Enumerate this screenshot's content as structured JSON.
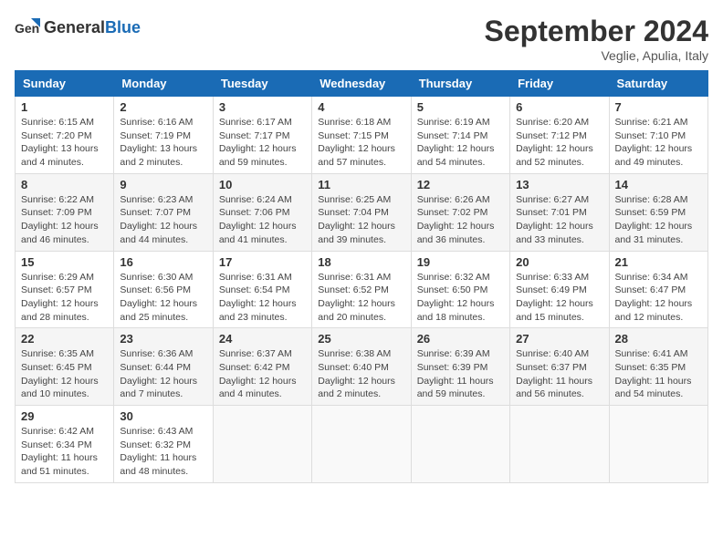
{
  "logo": {
    "text_general": "General",
    "text_blue": "Blue"
  },
  "title": "September 2024",
  "subtitle": "Veglie, Apulia, Italy",
  "weekdays": [
    "Sunday",
    "Monday",
    "Tuesday",
    "Wednesday",
    "Thursday",
    "Friday",
    "Saturday"
  ],
  "weeks": [
    [
      {
        "day": "1",
        "info": "Sunrise: 6:15 AM\nSunset: 7:20 PM\nDaylight: 13 hours\nand 4 minutes."
      },
      {
        "day": "2",
        "info": "Sunrise: 6:16 AM\nSunset: 7:19 PM\nDaylight: 13 hours\nand 2 minutes."
      },
      {
        "day": "3",
        "info": "Sunrise: 6:17 AM\nSunset: 7:17 PM\nDaylight: 12 hours\nand 59 minutes."
      },
      {
        "day": "4",
        "info": "Sunrise: 6:18 AM\nSunset: 7:15 PM\nDaylight: 12 hours\nand 57 minutes."
      },
      {
        "day": "5",
        "info": "Sunrise: 6:19 AM\nSunset: 7:14 PM\nDaylight: 12 hours\nand 54 minutes."
      },
      {
        "day": "6",
        "info": "Sunrise: 6:20 AM\nSunset: 7:12 PM\nDaylight: 12 hours\nand 52 minutes."
      },
      {
        "day": "7",
        "info": "Sunrise: 6:21 AM\nSunset: 7:10 PM\nDaylight: 12 hours\nand 49 minutes."
      }
    ],
    [
      {
        "day": "8",
        "info": "Sunrise: 6:22 AM\nSunset: 7:09 PM\nDaylight: 12 hours\nand 46 minutes."
      },
      {
        "day": "9",
        "info": "Sunrise: 6:23 AM\nSunset: 7:07 PM\nDaylight: 12 hours\nand 44 minutes."
      },
      {
        "day": "10",
        "info": "Sunrise: 6:24 AM\nSunset: 7:06 PM\nDaylight: 12 hours\nand 41 minutes."
      },
      {
        "day": "11",
        "info": "Sunrise: 6:25 AM\nSunset: 7:04 PM\nDaylight: 12 hours\nand 39 minutes."
      },
      {
        "day": "12",
        "info": "Sunrise: 6:26 AM\nSunset: 7:02 PM\nDaylight: 12 hours\nand 36 minutes."
      },
      {
        "day": "13",
        "info": "Sunrise: 6:27 AM\nSunset: 7:01 PM\nDaylight: 12 hours\nand 33 minutes."
      },
      {
        "day": "14",
        "info": "Sunrise: 6:28 AM\nSunset: 6:59 PM\nDaylight: 12 hours\nand 31 minutes."
      }
    ],
    [
      {
        "day": "15",
        "info": "Sunrise: 6:29 AM\nSunset: 6:57 PM\nDaylight: 12 hours\nand 28 minutes."
      },
      {
        "day": "16",
        "info": "Sunrise: 6:30 AM\nSunset: 6:56 PM\nDaylight: 12 hours\nand 25 minutes."
      },
      {
        "day": "17",
        "info": "Sunrise: 6:31 AM\nSunset: 6:54 PM\nDaylight: 12 hours\nand 23 minutes."
      },
      {
        "day": "18",
        "info": "Sunrise: 6:31 AM\nSunset: 6:52 PM\nDaylight: 12 hours\nand 20 minutes."
      },
      {
        "day": "19",
        "info": "Sunrise: 6:32 AM\nSunset: 6:50 PM\nDaylight: 12 hours\nand 18 minutes."
      },
      {
        "day": "20",
        "info": "Sunrise: 6:33 AM\nSunset: 6:49 PM\nDaylight: 12 hours\nand 15 minutes."
      },
      {
        "day": "21",
        "info": "Sunrise: 6:34 AM\nSunset: 6:47 PM\nDaylight: 12 hours\nand 12 minutes."
      }
    ],
    [
      {
        "day": "22",
        "info": "Sunrise: 6:35 AM\nSunset: 6:45 PM\nDaylight: 12 hours\nand 10 minutes."
      },
      {
        "day": "23",
        "info": "Sunrise: 6:36 AM\nSunset: 6:44 PM\nDaylight: 12 hours\nand 7 minutes."
      },
      {
        "day": "24",
        "info": "Sunrise: 6:37 AM\nSunset: 6:42 PM\nDaylight: 12 hours\nand 4 minutes."
      },
      {
        "day": "25",
        "info": "Sunrise: 6:38 AM\nSunset: 6:40 PM\nDaylight: 12 hours\nand 2 minutes."
      },
      {
        "day": "26",
        "info": "Sunrise: 6:39 AM\nSunset: 6:39 PM\nDaylight: 11 hours\nand 59 minutes."
      },
      {
        "day": "27",
        "info": "Sunrise: 6:40 AM\nSunset: 6:37 PM\nDaylight: 11 hours\nand 56 minutes."
      },
      {
        "day": "28",
        "info": "Sunrise: 6:41 AM\nSunset: 6:35 PM\nDaylight: 11 hours\nand 54 minutes."
      }
    ],
    [
      {
        "day": "29",
        "info": "Sunrise: 6:42 AM\nSunset: 6:34 PM\nDaylight: 11 hours\nand 51 minutes."
      },
      {
        "day": "30",
        "info": "Sunrise: 6:43 AM\nSunset: 6:32 PM\nDaylight: 11 hours\nand 48 minutes."
      },
      {
        "day": "",
        "info": ""
      },
      {
        "day": "",
        "info": ""
      },
      {
        "day": "",
        "info": ""
      },
      {
        "day": "",
        "info": ""
      },
      {
        "day": "",
        "info": ""
      }
    ]
  ]
}
